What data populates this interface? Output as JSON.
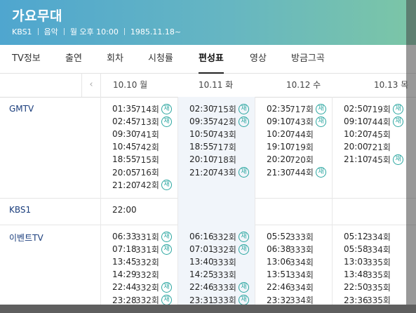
{
  "header": {
    "title": "가요무대",
    "channel": "KBS1",
    "genre": "음악",
    "schedule": "월 오후 10:00",
    "since": "1985.11.18~"
  },
  "tabs": [
    {
      "label": "TV정보"
    },
    {
      "label": "출연"
    },
    {
      "label": "회차"
    },
    {
      "label": "시청률"
    },
    {
      "label": "편성표",
      "active": true
    },
    {
      "label": "영상"
    },
    {
      "label": "방금그곡"
    }
  ],
  "days": [
    {
      "label": "10.10 월"
    },
    {
      "label": "10.11 화"
    },
    {
      "label": "10.12 수"
    },
    {
      "label": "10.13 목"
    }
  ],
  "prev_icon": "chevron-left-icon",
  "rerun_badge": "재",
  "rows": [
    {
      "channel": "GMTV",
      "cells": [
        [
          {
            "time": "01:35",
            "ep": "714회",
            "re": true
          },
          {
            "time": "02:45",
            "ep": "713회",
            "re": true
          },
          {
            "time": "09:30",
            "ep": "741회"
          },
          {
            "time": "10:45",
            "ep": "742회"
          },
          {
            "time": "18:55",
            "ep": "715회"
          },
          {
            "time": "20:05",
            "ep": "716회"
          },
          {
            "time": "21:20",
            "ep": "742회",
            "re": true
          }
        ],
        [
          {
            "time": "02:30",
            "ep": "715회",
            "re": true
          },
          {
            "time": "09:35",
            "ep": "742회",
            "re": true
          },
          {
            "time": "10:50",
            "ep": "743회"
          },
          {
            "time": "18:55",
            "ep": "717회"
          },
          {
            "time": "20:10",
            "ep": "718회"
          },
          {
            "time": "21:20",
            "ep": "743회",
            "re": true
          }
        ],
        [
          {
            "time": "02:35",
            "ep": "717회",
            "re": true
          },
          {
            "time": "09:10",
            "ep": "743회",
            "re": true
          },
          {
            "time": "10:20",
            "ep": "744회"
          },
          {
            "time": "19:10",
            "ep": "719회"
          },
          {
            "time": "20:20",
            "ep": "720회"
          },
          {
            "time": "21:30",
            "ep": "744회",
            "re": true
          }
        ],
        [
          {
            "time": "02:50",
            "ep": "719회",
            "re": true
          },
          {
            "time": "09:10",
            "ep": "744회",
            "re": true
          },
          {
            "time": "10:20",
            "ep": "745회"
          },
          {
            "time": "20:00",
            "ep": "721회"
          },
          {
            "time": "21:10",
            "ep": "745회",
            "re": true
          }
        ]
      ]
    },
    {
      "channel": "KBS1",
      "cells": [
        [
          {
            "time": "22:00",
            "ep": ""
          }
        ],
        [],
        [],
        []
      ]
    },
    {
      "channel": "이벤트TV",
      "cells": [
        [
          {
            "time": "06:33",
            "ep": "331회",
            "re": true
          },
          {
            "time": "07:18",
            "ep": "331회",
            "re": true
          },
          {
            "time": "13:45",
            "ep": "332회"
          },
          {
            "time": "14:29",
            "ep": "332회"
          },
          {
            "time": "22:44",
            "ep": "332회",
            "re": true
          },
          {
            "time": "23:28",
            "ep": "332회",
            "re": true
          }
        ],
        [
          {
            "time": "06:16",
            "ep": "332회",
            "re": true
          },
          {
            "time": "07:01",
            "ep": "332회",
            "re": true
          },
          {
            "time": "13:40",
            "ep": "333회"
          },
          {
            "time": "14:25",
            "ep": "333회"
          },
          {
            "time": "22:46",
            "ep": "333회",
            "re": true
          },
          {
            "time": "23:31",
            "ep": "333회",
            "re": true
          }
        ],
        [
          {
            "time": "05:52",
            "ep": "333회"
          },
          {
            "time": "06:38",
            "ep": "333회"
          },
          {
            "time": "13:06",
            "ep": "334회"
          },
          {
            "time": "13:51",
            "ep": "334회"
          },
          {
            "time": "22:46",
            "ep": "334회"
          },
          {
            "time": "23:32",
            "ep": "334회"
          }
        ],
        [
          {
            "time": "05:12",
            "ep": "334회"
          },
          {
            "time": "05:58",
            "ep": "334회"
          },
          {
            "time": "13:03",
            "ep": "335회"
          },
          {
            "time": "13:48",
            "ep": "335회"
          },
          {
            "time": "22:50",
            "ep": "335회"
          },
          {
            "time": "23:36",
            "ep": "335회"
          }
        ]
      ]
    }
  ]
}
